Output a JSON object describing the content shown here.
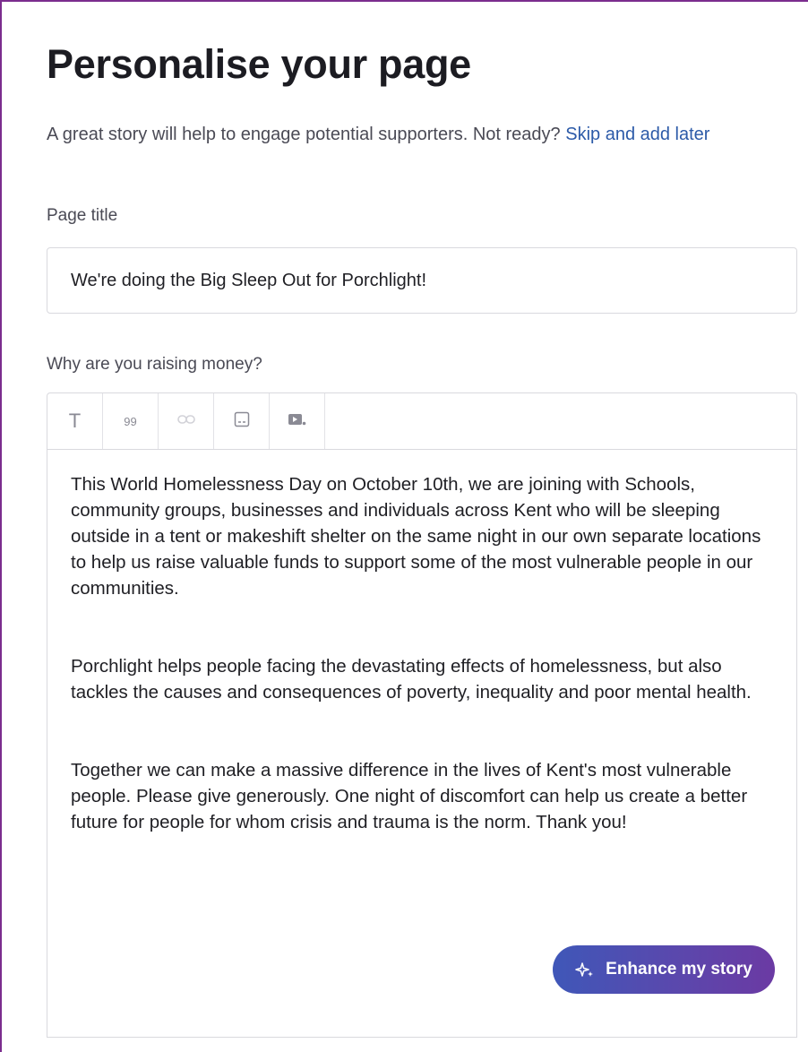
{
  "header": {
    "title": "Personalise your page",
    "intro_text": "A great story will help to engage potential supporters. Not ready? ",
    "skip_link": "Skip and add later"
  },
  "form": {
    "title_label": "Page title",
    "title_value": "We're doing the Big Sleep Out for Porchlight!",
    "story_label": "Why are you raising money?",
    "toolbar": {
      "items": [
        {
          "icon": "text-format-icon",
          "glyph": "T"
        },
        {
          "icon": "quote-icon",
          "glyph": "99"
        },
        {
          "icon": "link-icon",
          "glyph": ""
        },
        {
          "icon": "image-icon",
          "glyph": ""
        },
        {
          "icon": "video-icon",
          "glyph": ""
        }
      ]
    },
    "story_paragraphs": [
      "This World Homelessness Day on October 10th, we are joining with Schools, community groups, businesses and individuals across Kent who will be sleeping outside in a tent or makeshift shelter on the same night in our own separate locations to help us raise valuable funds to support some of the most vulnerable people in our communities.",
      "Porchlight helps people facing the devastating effects of homelessness, but also tackles the causes and consequences of poverty, inequality and poor mental health.",
      "Together we can make a massive difference in the lives of Kent's most vulnerable people. Please give generously. One night of discomfort can help us create a better future for people for whom crisis and trauma is the norm.  Thank you!"
    ],
    "enhance_button": "Enhance my story"
  },
  "colors": {
    "frame_border": "#7b2d8e",
    "link": "#2c5aa8",
    "button_gradient_start": "#3f57b8",
    "button_gradient_end": "#6b3aa3"
  }
}
